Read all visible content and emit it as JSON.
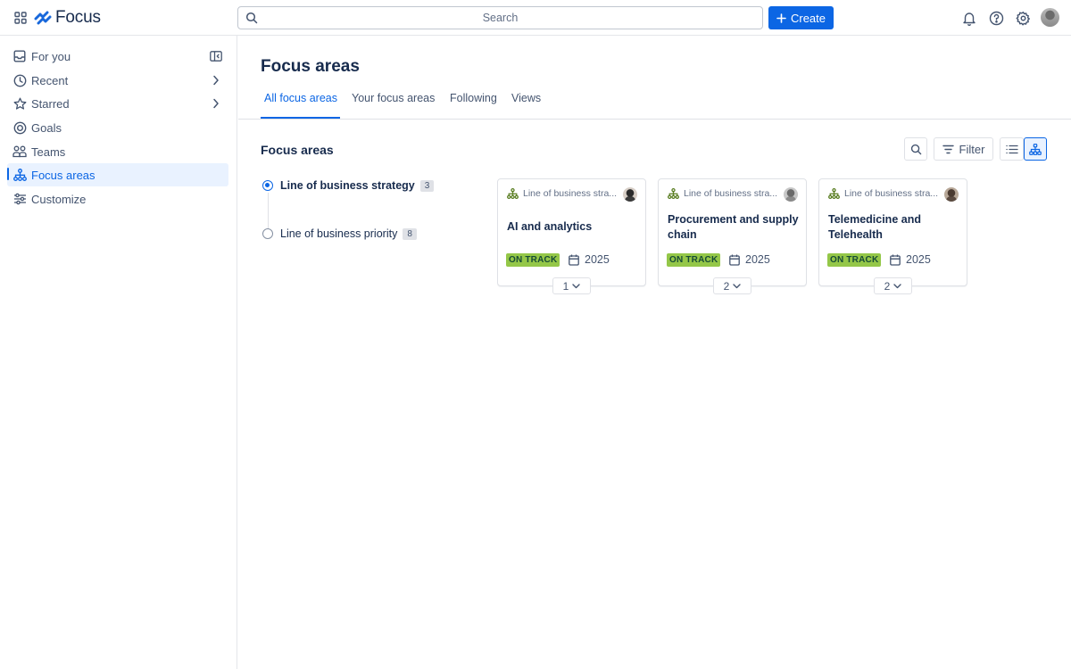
{
  "app": {
    "name": "Focus",
    "accent": "#0c66e4"
  },
  "search": {
    "placeholder": "Search"
  },
  "header": {
    "create_label": "Create"
  },
  "sidebar": {
    "items": [
      {
        "label": "For you",
        "icon": "inbox-icon"
      },
      {
        "label": "Recent",
        "icon": "clock-icon"
      },
      {
        "label": "Starred",
        "icon": "star-icon"
      },
      {
        "label": "Goals",
        "icon": "target-icon"
      },
      {
        "label": "Teams",
        "icon": "people-icon"
      },
      {
        "label": "Focus areas",
        "icon": "hierarchy-icon",
        "active": true
      },
      {
        "label": "Customize",
        "icon": "sliders-icon"
      }
    ]
  },
  "main": {
    "title": "Focus areas",
    "tabs": [
      {
        "label": "All focus areas",
        "active": true
      },
      {
        "label": "Your focus areas"
      },
      {
        "label": "Following"
      },
      {
        "label": "Views"
      }
    ],
    "section_title": "Focus areas",
    "filter_label": "Filter",
    "hierarchy": [
      {
        "label": "Line of business strategy",
        "count": "3",
        "selected": true
      },
      {
        "label": "Line of business priority",
        "count": "8",
        "selected": false
      }
    ],
    "cards": [
      {
        "parent": "Line of business stra...",
        "title": "AI and analytics",
        "status": "ON TRACK",
        "year": "2025",
        "children": "1"
      },
      {
        "parent": "Line of business stra...",
        "title": "Procurement and supply chain",
        "status": "ON TRACK",
        "year": "2025",
        "children": "2"
      },
      {
        "parent": "Line of business stra...",
        "title": "Telemedicine and Telehealth",
        "status": "ON TRACK",
        "year": "2025",
        "children": "2"
      }
    ],
    "status_color": "#94c748"
  }
}
